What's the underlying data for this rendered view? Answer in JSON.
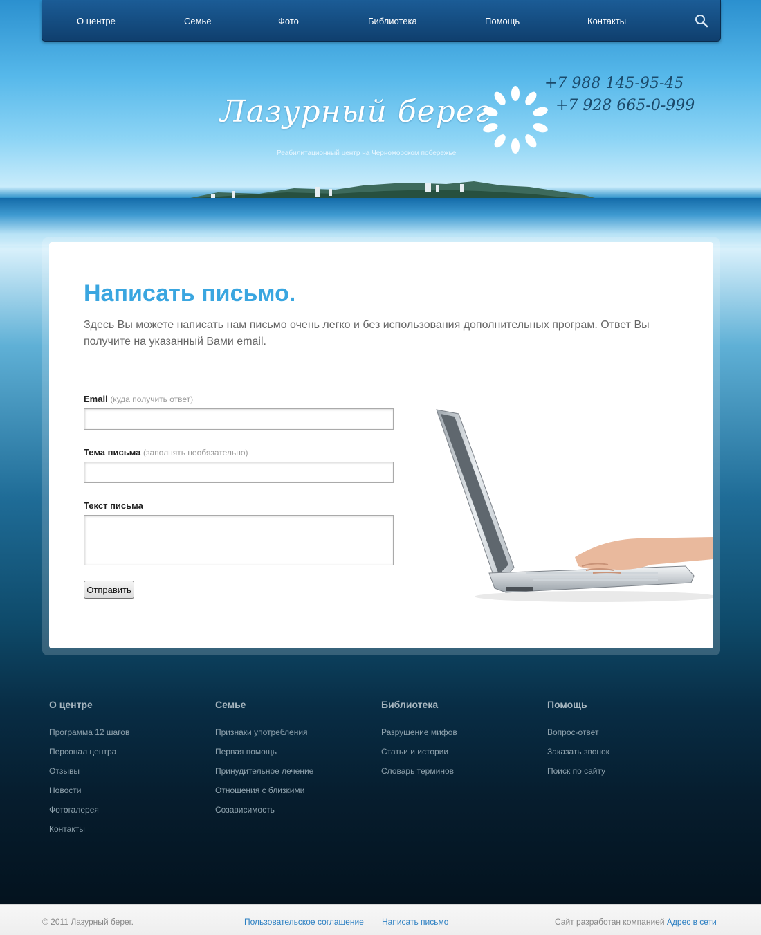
{
  "nav": {
    "items": [
      "О центре",
      "Семье",
      "Фото",
      "Библиотека",
      "Помощь",
      "Контакты"
    ],
    "search_icon": "search-icon"
  },
  "header": {
    "logo_text": "Лазурный берег",
    "tagline": "Реабилитационный центр на Черноморском побережье",
    "phones": [
      "+7 988 145-95-45",
      "+7 928 665-0-999"
    ]
  },
  "main": {
    "title": "Написать письмо.",
    "intro": "Здесь Вы можете написать нам письмо очень легко и без использования дополнительных програм. Ответ Вы получите на указанный Вами email.",
    "form": {
      "email_label": "Email",
      "email_hint": "(куда получить ответ)",
      "email_value": "",
      "subject_label": "Тема письма",
      "subject_hint": "(заполнять необязательно)",
      "subject_value": "",
      "body_label": "Текст письма",
      "body_value": "",
      "submit_label": "Отправить"
    }
  },
  "footer": {
    "columns": [
      {
        "title": "О центре",
        "links": [
          "Программа 12 шагов",
          "Персонал центра",
          "Отзывы",
          "Новости",
          "Фотогалерея",
          "Контакты"
        ]
      },
      {
        "title": "Семье",
        "links": [
          "Признаки употребления",
          "Первая помощь",
          "Принудительное лечение",
          "Отношения с близкими",
          "Созависимость"
        ]
      },
      {
        "title": "Библиотека",
        "links": [
          "Разрушение мифов",
          "Статьи и истории",
          "Словарь терминов"
        ]
      },
      {
        "title": "Помощь",
        "links": [
          "Вопрос-ответ",
          "Заказать звонок",
          "Поиск по сайту"
        ]
      }
    ]
  },
  "bottom": {
    "copyright": "© 2011 Лазурный берег.",
    "agreement_link": "Пользовательское соглашение",
    "write_link": "Написать письмо",
    "developer_text": "Сайт разработан компанией",
    "developer_link": "Адрес в сети"
  },
  "colors": {
    "accent": "#3aa6e0",
    "nav_bg": "#12467a",
    "link": "#2b7fc2"
  }
}
